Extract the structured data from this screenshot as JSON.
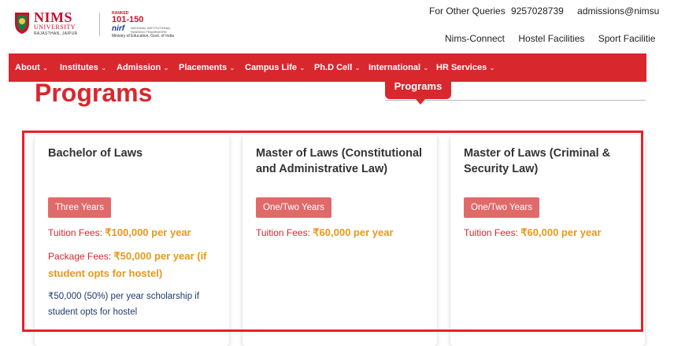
{
  "header": {
    "logo_title": "NIMS",
    "logo_sub": "UNIVERSITY",
    "logo_location": "RAJASTHAN, JAIPUR",
    "nirf_rank_prefix": "RANKED",
    "nirf_rank": "101-150",
    "nirf_word": "nirf",
    "nirf_tag": "NATIONAL INSTITUTIONAL RANKING FRAMEWORK",
    "nirf_ministry": "Ministry of Education, Govt. of India",
    "queries_label": "For Other Queries",
    "phone": "9257028739",
    "email": "admissions@nimsu",
    "quicklinks": [
      "Nims-Connect",
      "Hostel Facilities",
      "Sport Facilitie"
    ]
  },
  "nav": {
    "items": [
      "About",
      "Institutes",
      "Admission",
      "Placements",
      "Campus Life",
      "Ph.D Cell",
      "International",
      "HR Services"
    ]
  },
  "main": {
    "page_title": "Programs",
    "active_tab": "Programs"
  },
  "cards": [
    {
      "title": "Bachelor of Laws",
      "duration": "Three Years",
      "tuition_label": "Tuition Fees:",
      "tuition_value": "₹100,000 per year",
      "package_label": "Package Fees:",
      "package_value": "₹50,000 per year (if student opts for hostel)",
      "scholarship": "₹50,000 (50%) per year scholarship if student opts for hostel"
    },
    {
      "title": "Master of Laws (Constitutional and Administrative Law)",
      "duration": "One/Two Years",
      "tuition_label": "Tuition Fees:",
      "tuition_value": "₹60,000 per year"
    },
    {
      "title": "Master of Laws (Criminal & Security Law)",
      "duration": "One/Two Years",
      "tuition_label": "Tuition Fees:",
      "tuition_value": "₹60,000 per year"
    }
  ],
  "colors": {
    "brand_red": "#d9272e",
    "fee_orange": "#e8981c",
    "badge": "#e06a6a",
    "scholarship_blue": "#1f3a6e"
  }
}
